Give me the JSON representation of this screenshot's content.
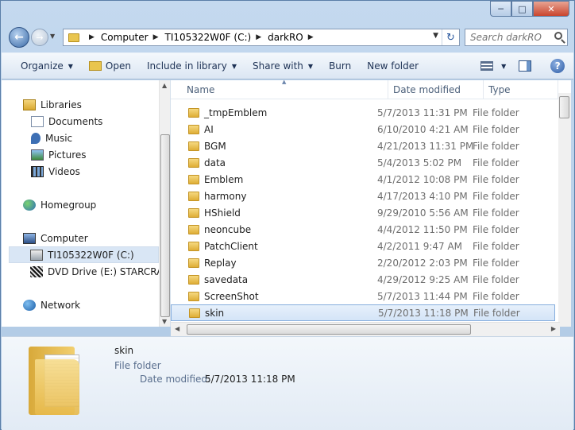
{
  "address": {
    "crumbs": [
      "Computer",
      "TI105322W0F (C:)",
      "darkRO"
    ]
  },
  "search": {
    "placeholder": "Search darkRO"
  },
  "toolbar": {
    "organize": "Organize",
    "open": "Open",
    "include": "Include in library",
    "share": "Share with",
    "burn": "Burn",
    "new_folder": "New folder"
  },
  "nav": {
    "libraries": "Libraries",
    "documents": "Documents",
    "music": "Music",
    "pictures": "Pictures",
    "videos": "Videos",
    "homegroup": "Homegroup",
    "computer": "Computer",
    "drive_c": "TI105322W0F (C:)",
    "drive_e": "DVD Drive (E:) STARCRAFT",
    "network": "Network"
  },
  "columns": {
    "name": "Name",
    "date": "Date modified",
    "type": "Type"
  },
  "files": [
    {
      "name": "_tmpEmblem",
      "date": "5/7/2013 11:31 PM",
      "type": "File folder"
    },
    {
      "name": "AI",
      "date": "6/10/2010 4:21 AM",
      "type": "File folder"
    },
    {
      "name": "BGM",
      "date": "4/21/2013 11:31 PM",
      "type": "File folder"
    },
    {
      "name": "data",
      "date": "5/4/2013 5:02 PM",
      "type": "File folder"
    },
    {
      "name": "Emblem",
      "date": "4/1/2012 10:08 PM",
      "type": "File folder"
    },
    {
      "name": "harmony",
      "date": "4/17/2013 4:10 PM",
      "type": "File folder"
    },
    {
      "name": "HShield",
      "date": "9/29/2010 5:56 AM",
      "type": "File folder"
    },
    {
      "name": "neoncube",
      "date": "4/4/2012 11:50 PM",
      "type": "File folder"
    },
    {
      "name": "PatchClient",
      "date": "4/2/2011 9:47 AM",
      "type": "File folder"
    },
    {
      "name": "Replay",
      "date": "2/20/2012 2:03 PM",
      "type": "File folder"
    },
    {
      "name": "savedata",
      "date": "4/29/2012 9:25 AM",
      "type": "File folder"
    },
    {
      "name": "ScreenShot",
      "date": "5/7/2013 11:44 PM",
      "type": "File folder"
    },
    {
      "name": "skin",
      "date": "5/7/2013 11:18 PM",
      "type": "File folder"
    }
  ],
  "details": {
    "name": "skin",
    "type": "File folder",
    "modified_label": "Date modified:",
    "modified_value": "5/7/2013 11:18 PM"
  }
}
